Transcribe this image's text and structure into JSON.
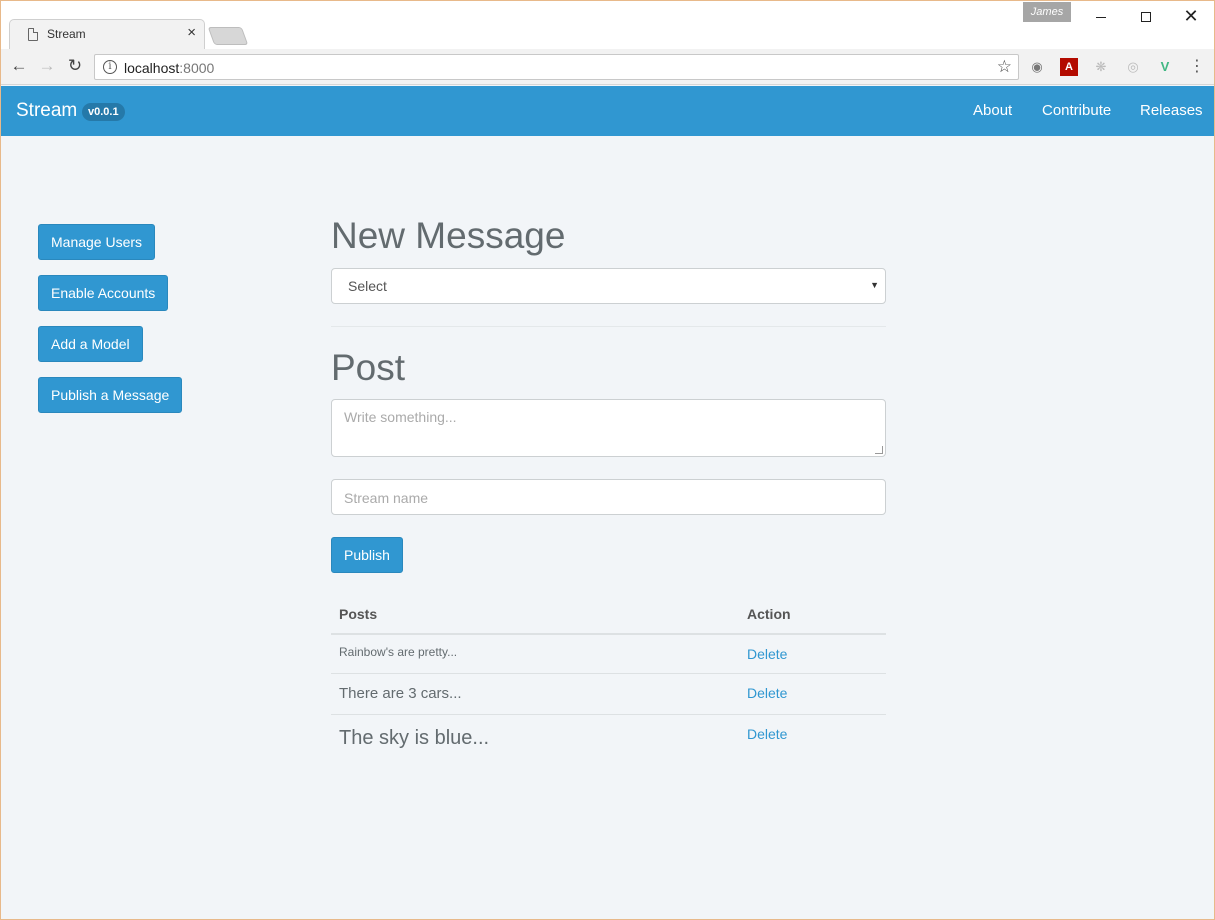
{
  "browser": {
    "tab_title": "Stream",
    "tab_close": "×",
    "profile_name": "James",
    "url_host": "localhost",
    "url_port": ":8000",
    "window_close": "✕"
  },
  "navbar": {
    "brand": "Stream",
    "version": "v0.0.1",
    "links": [
      "About",
      "Contribute",
      "Releases"
    ],
    "background": "#3097d1"
  },
  "sidebar": {
    "buttons": [
      "Manage Users",
      "Enable Accounts",
      "Add a Model",
      "Publish a Message"
    ]
  },
  "main": {
    "new_message_heading": "New Message",
    "select_value": "Select",
    "post_heading": "Post",
    "textarea_placeholder": "Write something...",
    "stream_placeholder": "Stream name",
    "publish_label": "Publish"
  },
  "table": {
    "headers": [
      "Posts",
      "Action"
    ],
    "rows": [
      {
        "post": "Rainbow's are pretty...",
        "action": "Delete"
      },
      {
        "post": "There are 3 cars...",
        "action": "Delete"
      },
      {
        "post": "The sky is blue...",
        "action": "Delete"
      }
    ]
  }
}
